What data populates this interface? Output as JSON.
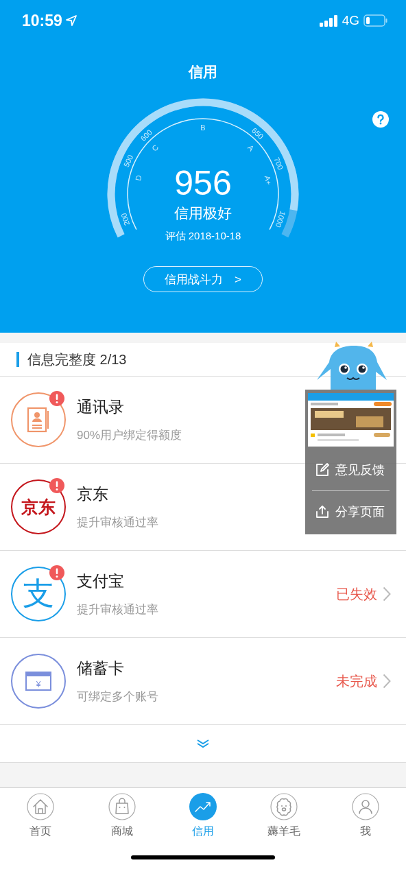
{
  "status_bar": {
    "time": "10:59",
    "network": "4G"
  },
  "header": {
    "title": "信用"
  },
  "gauge": {
    "scale_labels": [
      "200",
      "500",
      "600",
      "650",
      "700",
      "1000"
    ],
    "grade_labels": [
      "D",
      "C",
      "B",
      "A",
      "A+"
    ],
    "score": "956",
    "rating": "信用极好",
    "date": "评估 2018-10-18"
  },
  "power_button": {
    "label": "信用战斗力",
    "arrow": ">"
  },
  "section": {
    "title": "信息完整度 2/13"
  },
  "items": [
    {
      "kind": "contacts",
      "title": "通讯录",
      "subtitle": "90%用户绑定得额度",
      "alert": true
    },
    {
      "kind": "jd",
      "logo_text": "京东",
      "title": "京东",
      "subtitle": "提升审核通过率",
      "alert": true
    },
    {
      "kind": "alipay",
      "logo_text": "支",
      "title": "支付宝",
      "subtitle": "提升审核通过率",
      "alert": true,
      "status": "已失效"
    },
    {
      "kind": "card",
      "logo_text": "¥",
      "title": "储蓄卡",
      "subtitle": "可绑定多个账号",
      "alert": false,
      "status": "未完成"
    }
  ],
  "float_menu": {
    "actions": [
      {
        "kind": "feedback",
        "label": "意见反馈"
      },
      {
        "kind": "share",
        "label": "分享页面"
      }
    ]
  },
  "tabs": [
    {
      "kind": "home",
      "label": "首页",
      "selected": false
    },
    {
      "kind": "shop",
      "label": "商城",
      "selected": false
    },
    {
      "kind": "credit",
      "label": "信用",
      "selected": true
    },
    {
      "kind": "deals",
      "label": "薅羊毛",
      "selected": false
    },
    {
      "kind": "me",
      "label": "我",
      "selected": false
    }
  ]
}
